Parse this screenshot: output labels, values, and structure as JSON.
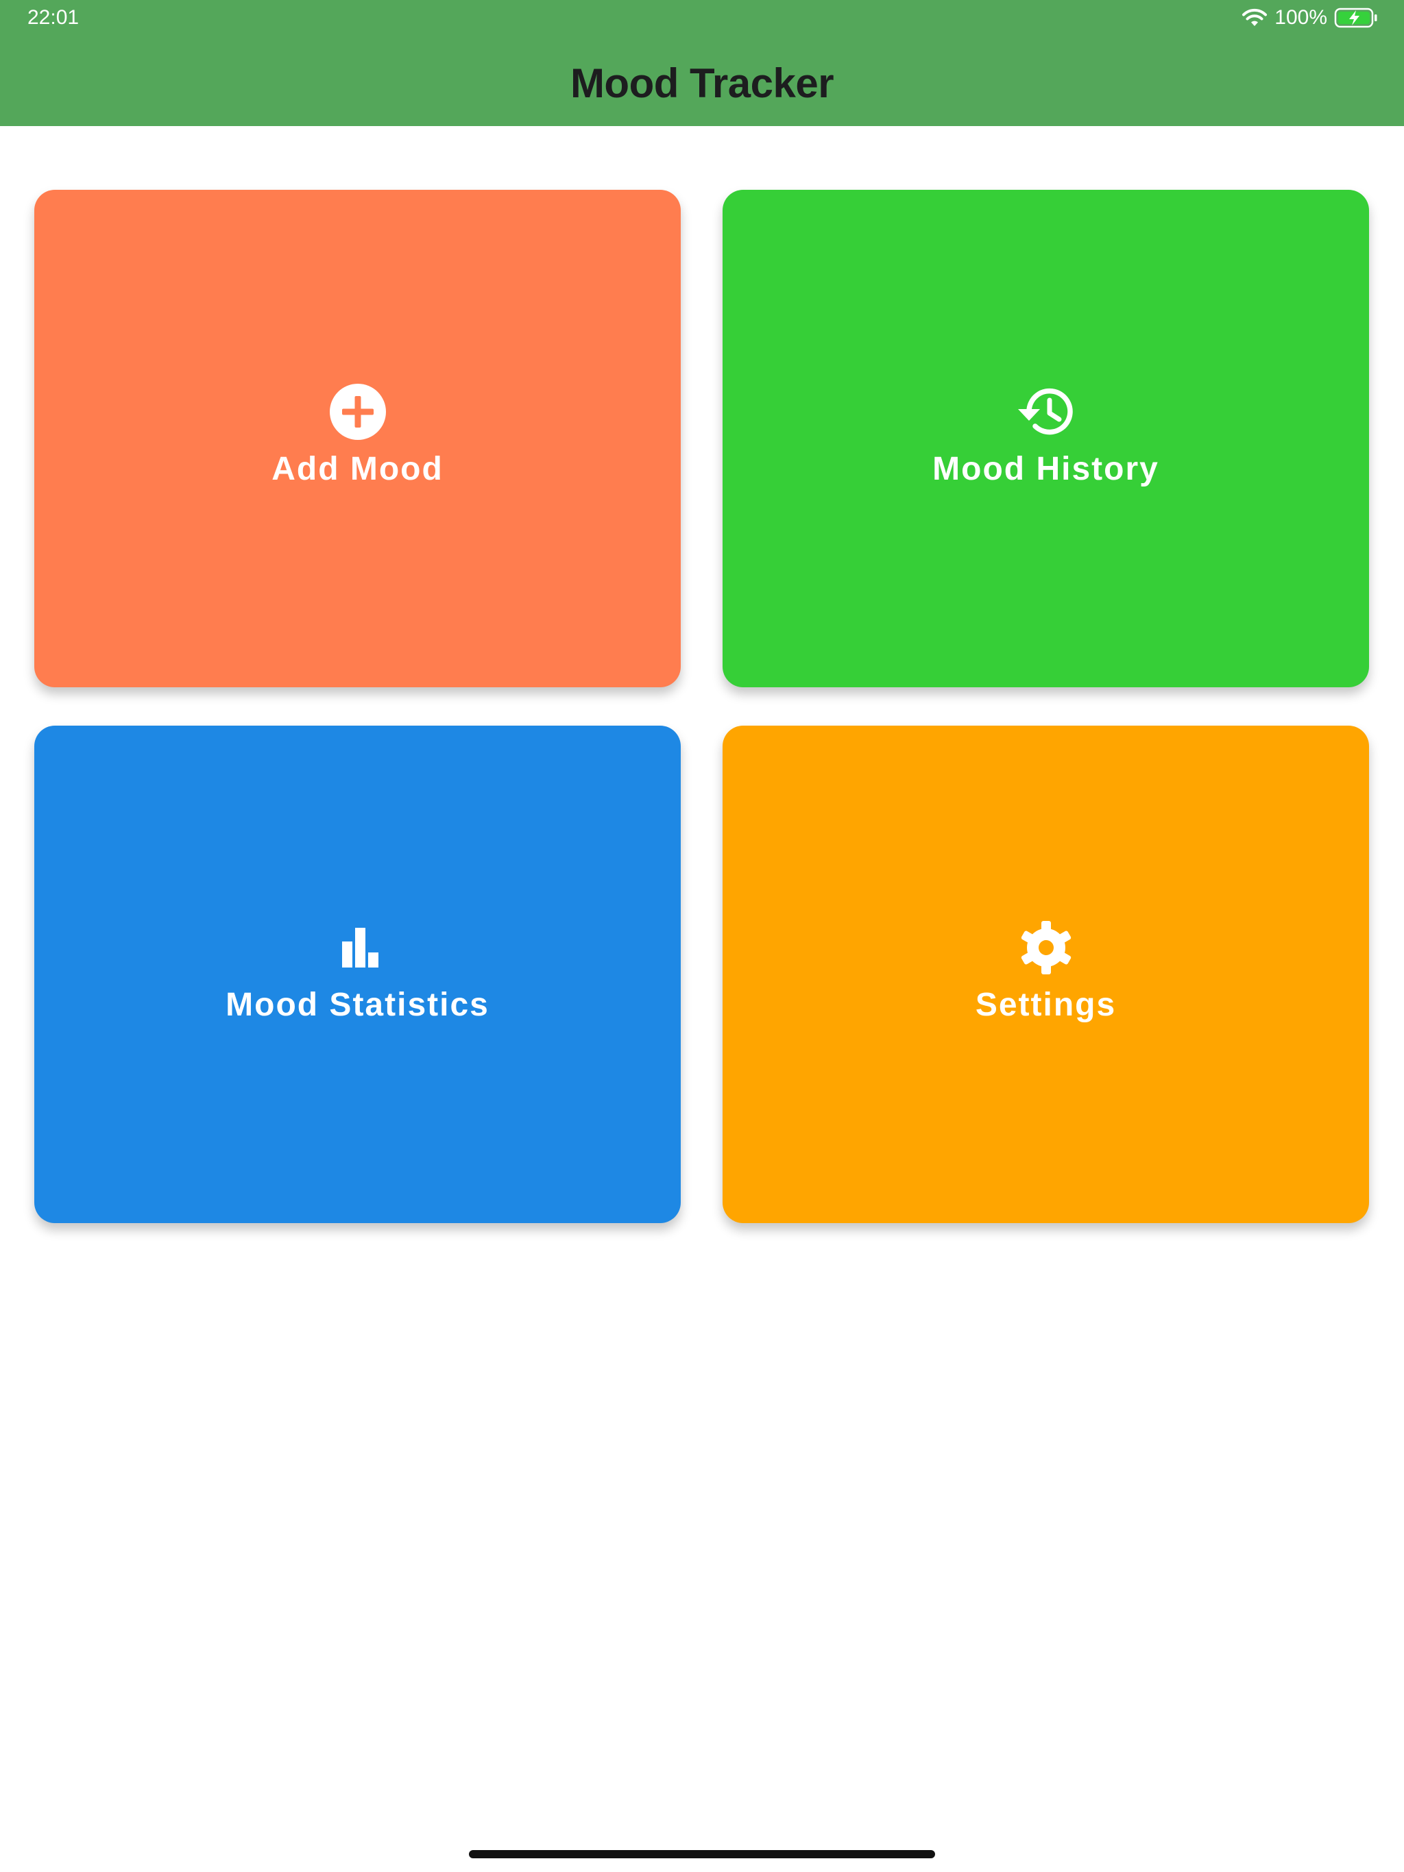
{
  "status_bar": {
    "time": "22:01",
    "battery": "100%",
    "icons": [
      "wifi-icon",
      "battery-charging-icon"
    ]
  },
  "header": {
    "title": "Mood Tracker",
    "background": "#54a75a"
  },
  "tiles": [
    {
      "label": "Add Mood",
      "icon": "add-circle-icon",
      "color": "#ff7d4f"
    },
    {
      "label": "Mood History",
      "icon": "history-icon",
      "color": "#36cf37"
    },
    {
      "label": "Mood Statistics",
      "icon": "bar-chart-icon",
      "color": "#1e88e4"
    },
    {
      "label": "Settings",
      "icon": "gear-icon",
      "color": "#ffa500"
    }
  ]
}
